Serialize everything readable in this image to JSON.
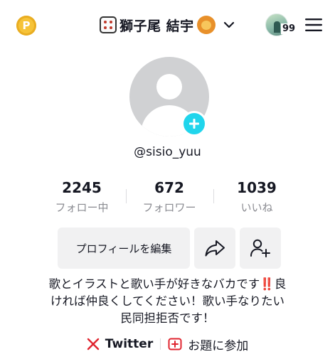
{
  "header": {
    "display_name": "獅子尾 結宇",
    "notification_count": "99",
    "coin_symbol": "P"
  },
  "profile": {
    "username": "@sisio_yuu"
  },
  "stats": [
    {
      "value": "2245",
      "label": "フォロー中"
    },
    {
      "value": "672",
      "label": "フォロワー"
    },
    {
      "value": "1039",
      "label": "いいね"
    }
  ],
  "actions": {
    "edit_profile_label": "プロフィールを編集"
  },
  "bio": {
    "line1_before": "歌とイラストと歌い手が好きなバカです",
    "line1_mark": "‼️",
    "line1_after": "良",
    "line2": "ければ仲良くしてください！歌い手なりたい",
    "line3": "民同担拒否です！"
  },
  "links": {
    "twitter_label": "Twitter",
    "topic_label": "お題に参加"
  },
  "colors": {
    "accent_cyan": "#20d5ec",
    "twitter_red": "#e0242f",
    "coin_gold": "#f6c338",
    "secondary_text": "#8a8b91",
    "button_bg": "#f1f1f2"
  }
}
